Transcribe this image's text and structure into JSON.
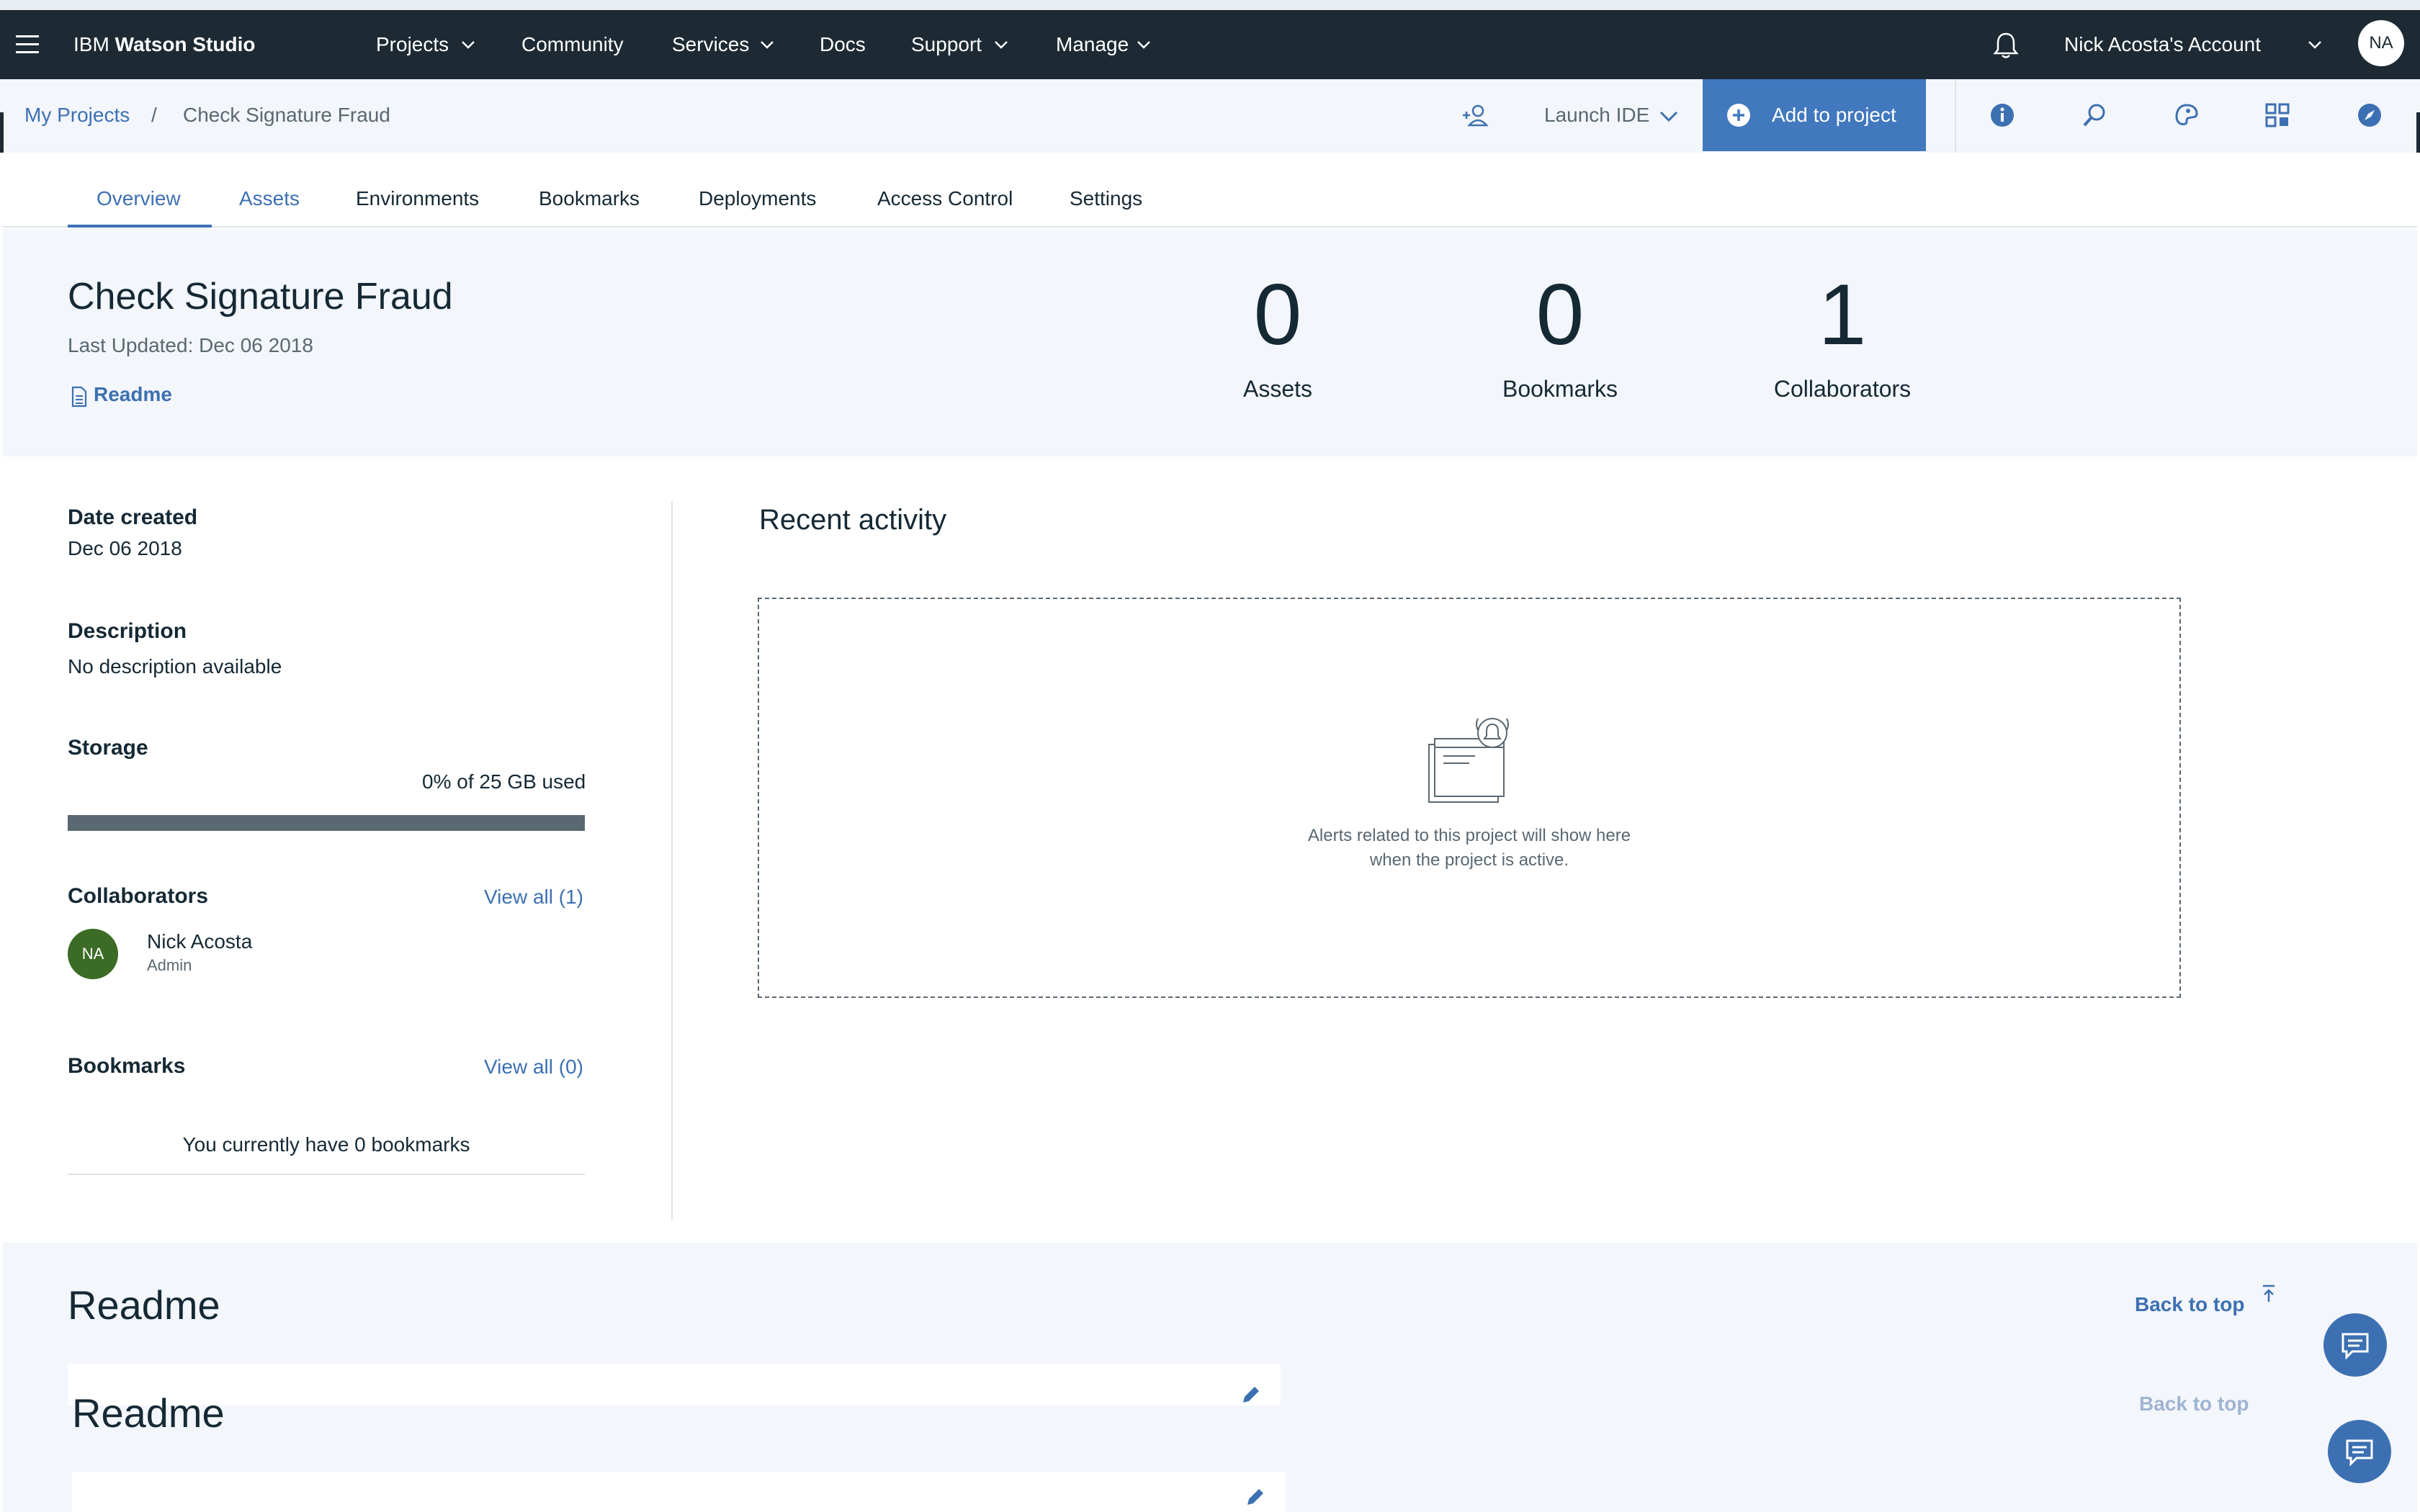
{
  "topbar": {
    "brand_prefix": "IBM",
    "brand_name": "Watson Studio",
    "nav": [
      "Projects",
      "Community",
      "Services",
      "Docs",
      "Support",
      "Manage"
    ],
    "account": "Nick Acosta's Account",
    "avatar": "NA"
  },
  "breadcrumb": {
    "root": "My Projects",
    "separator": "/",
    "current": "Check Signature Fraud"
  },
  "actions": {
    "launch_ide": "Launch IDE",
    "add_to_project": "Add to project"
  },
  "tabs": [
    "Overview",
    "Assets",
    "Environments",
    "Bookmarks",
    "Deployments",
    "Access Control",
    "Settings"
  ],
  "active_tab": "Overview",
  "project": {
    "title": "Check Signature Fraud",
    "last_updated": "Last Updated: Dec 06 2018",
    "readme_link": "Readme"
  },
  "stats": [
    {
      "value": "0",
      "label": "Assets"
    },
    {
      "value": "0",
      "label": "Bookmarks"
    },
    {
      "value": "1",
      "label": "Collaborators"
    }
  ],
  "details": {
    "date_created_label": "Date created",
    "date_created": "Dec 06 2018",
    "description_label": "Description",
    "description": "No description available",
    "storage_label": "Storage",
    "storage_used": "0% of 25 GB used",
    "storage_fraction": 0.0,
    "collaborators_label": "Collaborators",
    "collaborators_view_all": "View all (1)",
    "collaborator_name": "Nick Acosta",
    "collaborator_role": "Admin",
    "collaborator_initials": "NA",
    "bookmarks_label": "Bookmarks",
    "bookmarks_view_all": "View all (0)",
    "bookmarks_empty": "You currently have 0 bookmarks"
  },
  "recent": {
    "title": "Recent activity",
    "empty_line1": "Alerts related to this project will show here",
    "empty_line2": "when the project is active."
  },
  "readme": {
    "title": "Readme",
    "back_to_top": "Back to top"
  },
  "icons": [
    "menu-icon",
    "chevron-down-icon",
    "bell-icon",
    "add-collaborator-icon",
    "plus-circle-icon",
    "info-icon",
    "search-icon",
    "palette-icon",
    "apps-icon",
    "compass-icon",
    "document-icon",
    "arrow-up-icon",
    "edit-icon",
    "chat-icon"
  ],
  "colors": {
    "topbar": "#1d2a33",
    "accent": "#3d70b2",
    "button": "#4178be",
    "panel": "#f3f6fb"
  }
}
